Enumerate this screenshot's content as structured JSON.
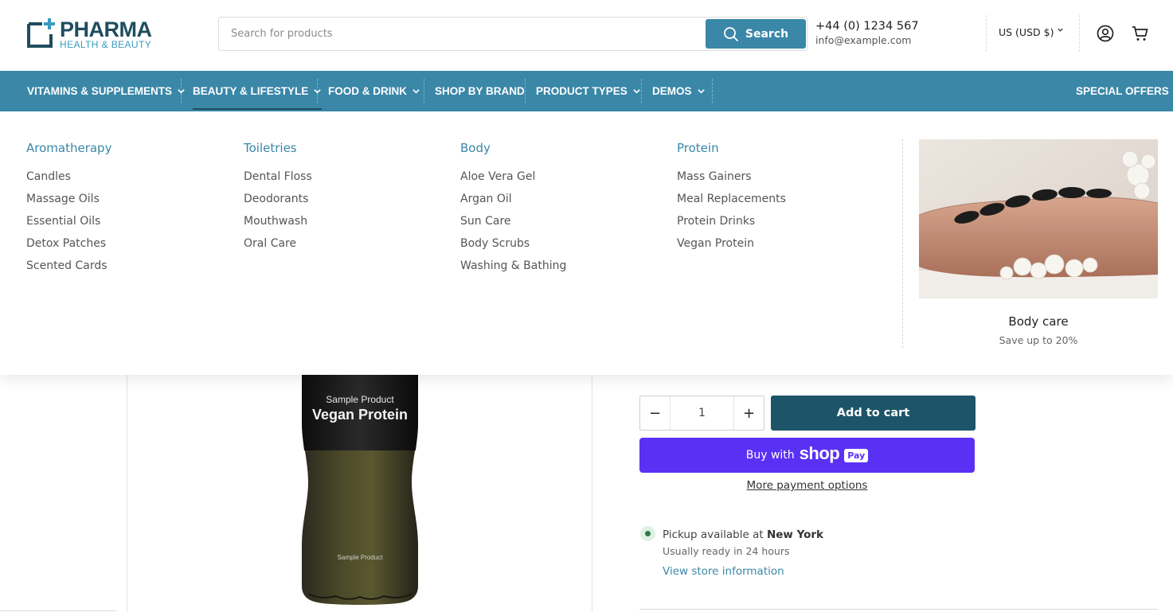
{
  "header": {
    "logo": {
      "main": "PHARMA",
      "sub": "HEALTH & BEAUTY"
    },
    "search": {
      "placeholder": "Search for products",
      "button_label": "Search"
    },
    "contact": {
      "phone": "+44 (0) 1234 567",
      "email": "info@example.com"
    },
    "currency": "US (USD $)",
    "icons": [
      "user-icon",
      "cart-icon"
    ]
  },
  "nav": {
    "items": [
      {
        "label": "VITAMINS & SUPPLEMENTS",
        "has_dropdown": true
      },
      {
        "label": "BEAUTY & LIFESTYLE",
        "has_dropdown": true,
        "active": true
      },
      {
        "label": "FOOD & DRINK",
        "has_dropdown": true
      },
      {
        "label": "SHOP BY BRAND",
        "has_dropdown": false
      },
      {
        "label": "PRODUCT TYPES",
        "has_dropdown": true
      },
      {
        "label": "DEMOS",
        "has_dropdown": true
      }
    ],
    "special": "SPECIAL OFFERS"
  },
  "mega_menu": {
    "columns": [
      {
        "heading": "Aromatherapy",
        "links": [
          "Candles",
          "Massage Oils",
          "Essential Oils",
          "Detox Patches",
          "Scented Cards"
        ]
      },
      {
        "heading": "Toiletries",
        "links": [
          "Dental Floss",
          "Deodorants",
          "Mouthwash",
          "Oral Care"
        ]
      },
      {
        "heading": "Body",
        "links": [
          "Aloe Vera Gel",
          "Argan Oil",
          "Sun Care",
          "Body Scrubs",
          "Washing & Bathing"
        ]
      },
      {
        "heading": "Protein",
        "links": [
          "Mass Gainers",
          "Meal Replacements",
          "Protein Drinks",
          "Vegan Protein"
        ]
      }
    ],
    "promo": {
      "title": "Body care",
      "subtitle": "Save up to 20%"
    }
  },
  "product": {
    "bottle": {
      "small_top": "Sample Product",
      "name": "Vegan Protein",
      "small_bottom": "Sample Product"
    },
    "quantity": "1",
    "add_to_cart": "Add to cart",
    "shop_pay": {
      "buy_with": "Buy with",
      "shop": "shop",
      "pay": "Pay"
    },
    "more_payment": "More payment options",
    "pickup": {
      "prefix": "Pickup available at",
      "location": "New York",
      "ready": "Usually ready in 24 hours",
      "store_link": "View store information"
    }
  },
  "colors": {
    "primary": "#3a87a8",
    "dark": "#1e5468",
    "shop_pay": "#5a31f4"
  }
}
